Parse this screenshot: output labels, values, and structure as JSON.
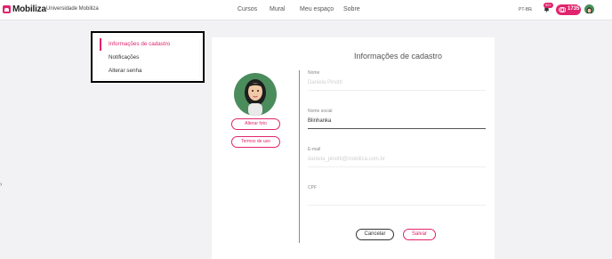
{
  "header": {
    "logo_text": "Mobiliza",
    "org_name": "Universidade Mobiliza",
    "nav": [
      "Cursos",
      "Mural",
      "Meu espaço",
      "Sobre"
    ],
    "language": "PT-BR",
    "notification_badge": "99+",
    "points": "1735"
  },
  "sidebar": {
    "items": [
      {
        "label": "Informações de cadastro",
        "active": true
      },
      {
        "label": "Notificações",
        "active": false
      },
      {
        "label": "Alterar senha",
        "active": false
      }
    ]
  },
  "profile": {
    "title": "Informações de cadastro",
    "change_photo_label": "Alterar foto",
    "terms_label": "Termos de uso",
    "fields": [
      {
        "label": "Nome",
        "value": "Daniela Pinotti",
        "disabled": true
      },
      {
        "label": "Nome social",
        "value": "Blinhanka",
        "disabled": false
      },
      {
        "label": "E-mail",
        "value": "daniela_pinotti@mobiliza.com.br",
        "disabled": true
      },
      {
        "label": "CPF",
        "value": "",
        "disabled": true
      }
    ],
    "cancel_label": "Cancelar",
    "save_label": "Salvar"
  },
  "colors": {
    "accent": "#e0246d",
    "avatar_bg": "#4b8c5c"
  }
}
